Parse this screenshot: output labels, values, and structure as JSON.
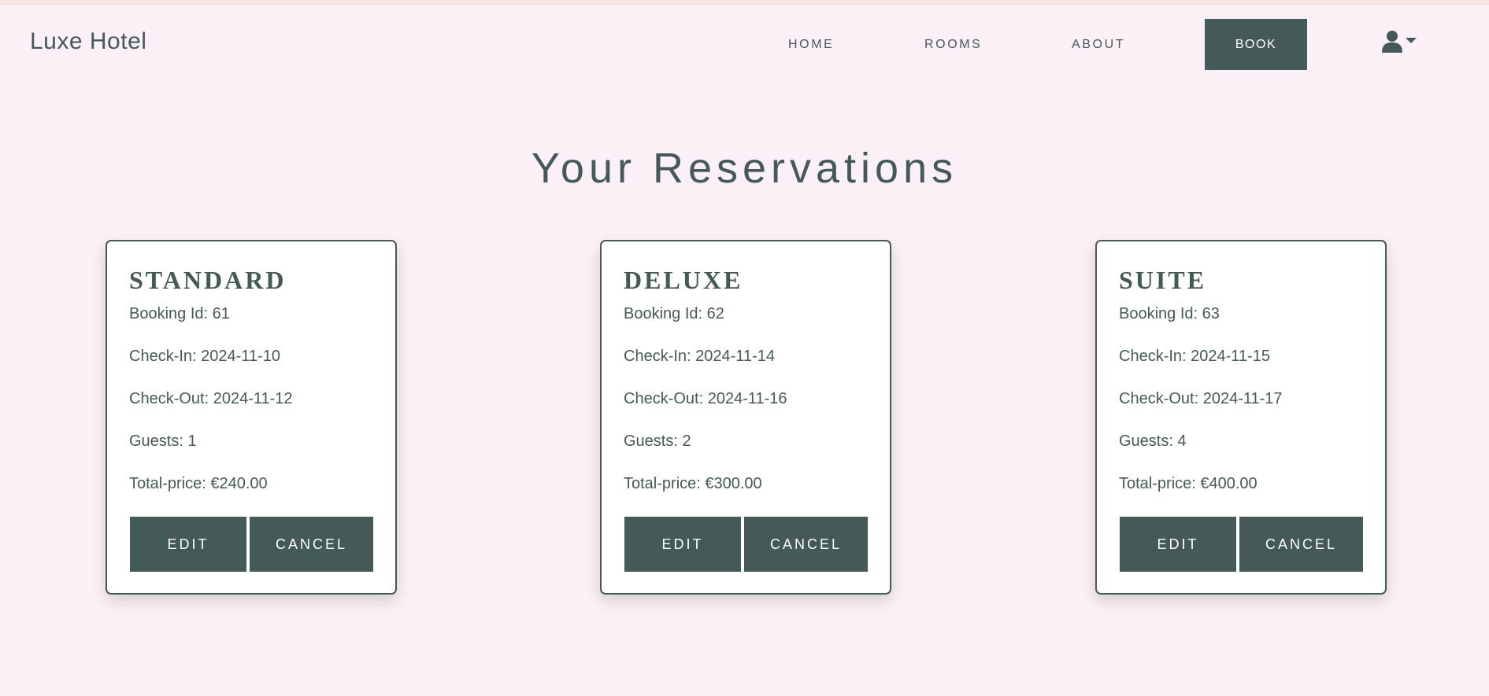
{
  "navbar": {
    "brand": "Luxe Hotel",
    "links": [
      "HOME",
      "ROOMS",
      "ABOUT"
    ],
    "book_label": "BOOK",
    "user_icon": "user-icon",
    "dropdown_icon": "caret-down-icon"
  },
  "page": {
    "title": "Your Reservations"
  },
  "reservations": [
    {
      "room": "STANDARD",
      "booking_id": "Booking Id: 61",
      "check_in": "Check-In: 2024-11-10",
      "check_out": "Check-Out: 2024-11-12",
      "guests": "Guests: 1",
      "total_price": "Total-price: €240.00",
      "edit_label": "EDIT",
      "cancel_label": "CANCEL"
    },
    {
      "room": "DELUXE",
      "booking_id": "Booking Id: 62",
      "check_in": "Check-In: 2024-11-14",
      "check_out": "Check-Out: 2024-11-16",
      "guests": "Guests: 2",
      "total_price": "Total-price: €300.00",
      "edit_label": "EDIT",
      "cancel_label": "CANCEL"
    },
    {
      "room": "SUITE",
      "booking_id": "Booking Id: 63",
      "check_in": "Check-In: 2024-11-15",
      "check_out": "Check-Out: 2024-11-17",
      "guests": "Guests: 4",
      "total_price": "Total-price: €400.00",
      "edit_label": "EDIT",
      "cancel_label": "CANCEL"
    }
  ],
  "colors": {
    "background": "#fbf0f5",
    "accent": "#435a56",
    "card": "#ffffff"
  }
}
